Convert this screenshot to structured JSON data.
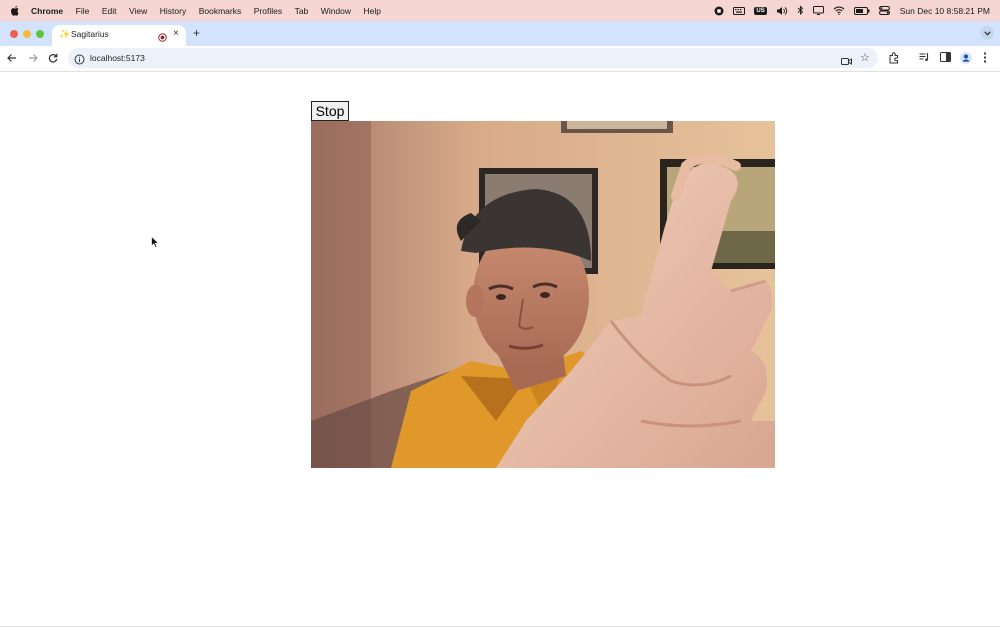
{
  "menubar": {
    "app_name": "Chrome",
    "menus": [
      "File",
      "Edit",
      "View",
      "History",
      "Bookmarks",
      "Profiles",
      "Tab",
      "Window",
      "Help"
    ],
    "input_source": "US",
    "clock": "Sun Dec 10  8:58:21 PM"
  },
  "browser": {
    "tab_title": "Sagitarius",
    "new_tab_symbol": "+",
    "close_symbol": "×",
    "url": "localhost:5173"
  },
  "page": {
    "stop_label": "Stop"
  },
  "colors": {
    "menubar_bg": "#f6d6d3",
    "tabstrip_bg": "#d3e3fd",
    "omnibox_bg": "#edf2fa",
    "shirt": "#e0982a"
  }
}
